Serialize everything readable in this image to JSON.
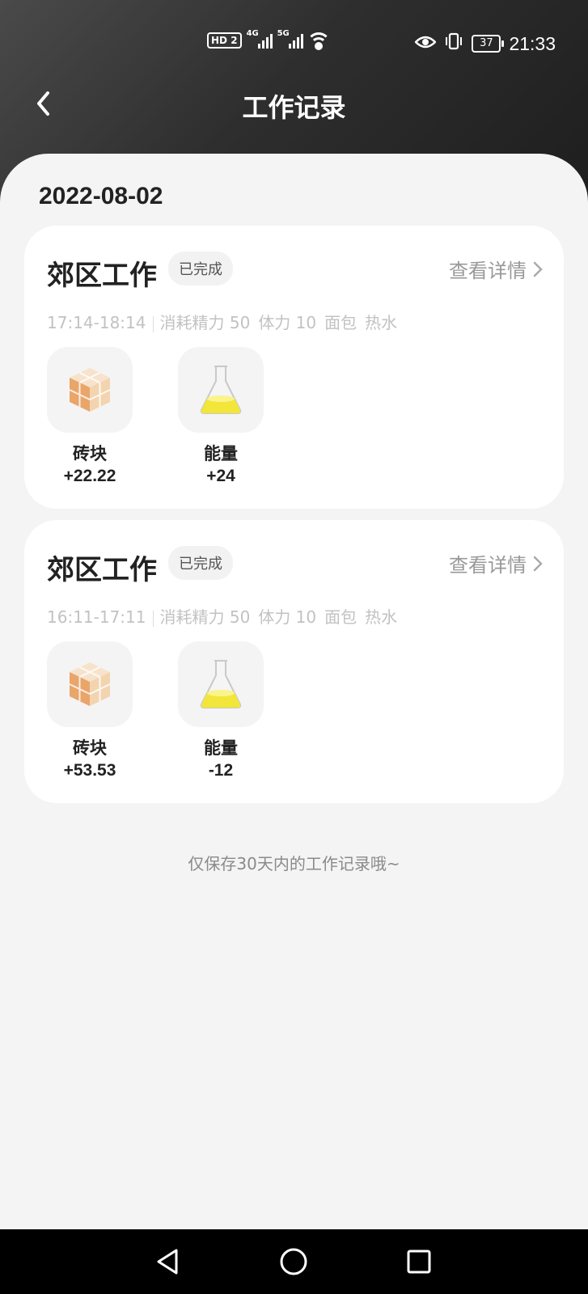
{
  "status_bar": {
    "left_badge": "HD",
    "left_badge_num": "2",
    "net1": "4G",
    "net2": "5G",
    "battery": "37",
    "time": "21:33"
  },
  "header": {
    "title": "工作记录"
  },
  "date": "2022-08-02",
  "records": [
    {
      "title": "郊区工作",
      "status": "已完成",
      "detail_link": "查看详情",
      "time_range": "17:14-18:14",
      "meta": [
        "消耗精力 50",
        "体力 10",
        "面包",
        "热水"
      ],
      "rewards": [
        {
          "icon": "brick-cube-icon",
          "name": "砖块",
          "value": "+22.22"
        },
        {
          "icon": "energy-flask-icon",
          "name": "能量",
          "value": "+24"
        }
      ]
    },
    {
      "title": "郊区工作",
      "status": "已完成",
      "detail_link": "查看详情",
      "time_range": "16:11-17:11",
      "meta": [
        "消耗精力 50",
        "体力 10",
        "面包",
        "热水"
      ],
      "rewards": [
        {
          "icon": "brick-cube-icon",
          "name": "砖块",
          "value": "+53.53"
        },
        {
          "icon": "energy-flask-icon",
          "name": "能量",
          "value": "-12"
        }
      ]
    }
  ],
  "footer_note": "仅保存30天内的工作记录哦~",
  "colors": {
    "header_dark": "#2e2e2e",
    "background": "#f4f4f4",
    "flask_liquid": "#f2e63a",
    "brick": "#e9a56a"
  }
}
